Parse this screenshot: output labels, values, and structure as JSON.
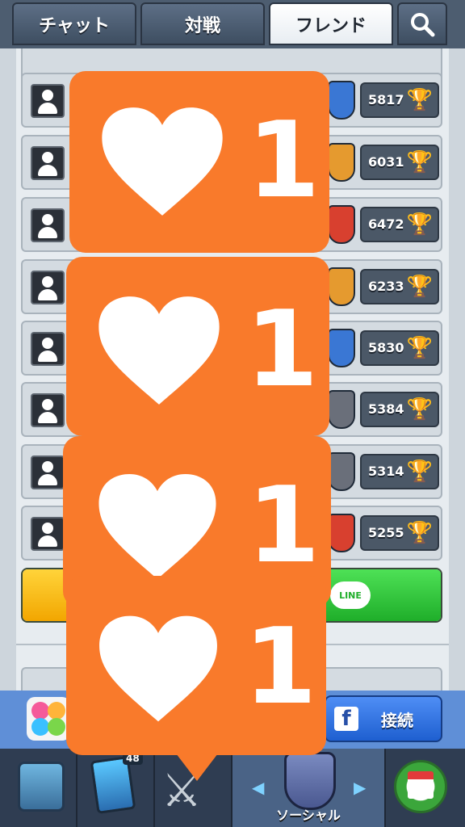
{
  "tabs": [
    {
      "label": "チャット"
    },
    {
      "label": "対戦"
    },
    {
      "label": "フレンド",
      "active": true
    },
    {
      "icon": "search-icon"
    }
  ],
  "friends": [
    {
      "trophies": "5817",
      "badge_color": "#3a77d4"
    },
    {
      "trophies": "6031",
      "badge_color": "#e59a2f"
    },
    {
      "trophies": "6472",
      "badge_color": "#d8402f"
    },
    {
      "trophies": "6233",
      "badge_color": "#e59a2f"
    },
    {
      "trophies": "5830",
      "badge_color": "#3a77d4"
    },
    {
      "trophies": "5384",
      "badge_color": "#6a6f7a"
    },
    {
      "trophies": "5314",
      "badge_color": "#6a6f7a"
    },
    {
      "trophies": "5255",
      "badge_color": "#d8402f"
    }
  ],
  "line_button": {
    "bubble_text": "LINE"
  },
  "connect": {
    "label": "接続",
    "fb_glyph": "f"
  },
  "nav": {
    "cards_count": "48",
    "social_label": "ソーシャル",
    "arrow_left": "◀",
    "arrow_right": "▶"
  },
  "likes": [
    {
      "count": "1"
    },
    {
      "count": "1"
    },
    {
      "count": "1"
    },
    {
      "count": "1"
    }
  ],
  "colors": {
    "like_orange": "#f97a2b",
    "tab_active": "#ffffff",
    "connect_blue": "#2a6fe0"
  }
}
